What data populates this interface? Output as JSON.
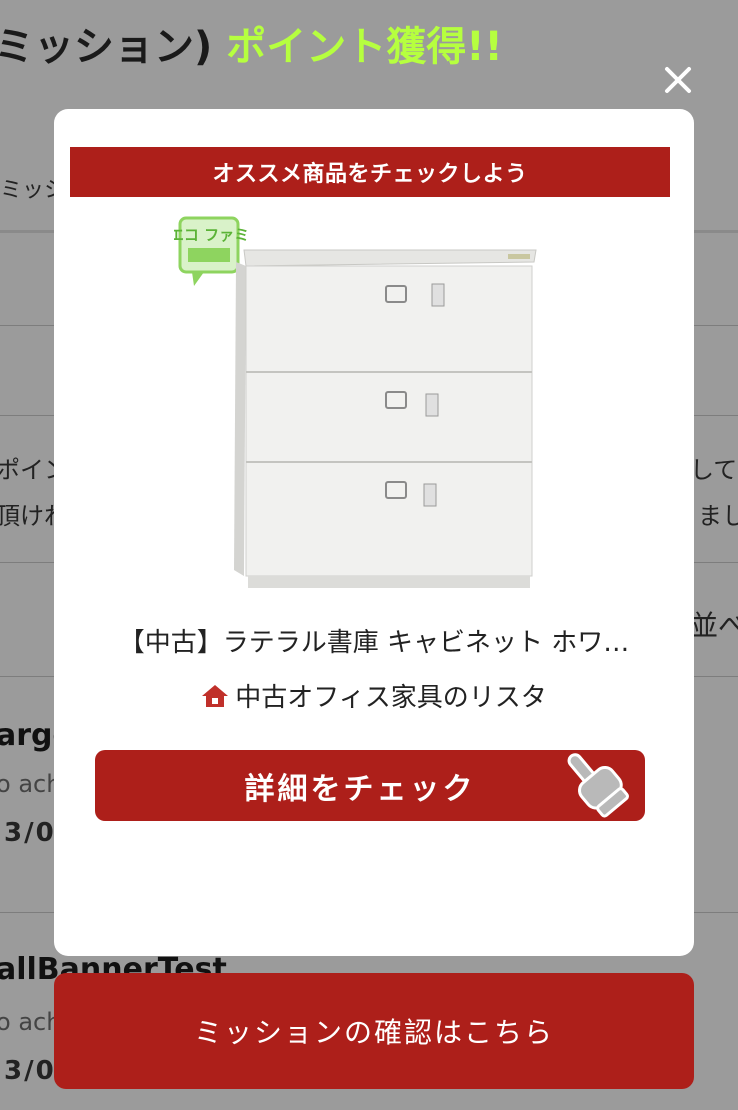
{
  "background": {
    "title_prefix": "ミッション)",
    "title_highlight": "ポイント獲得!!",
    "tab_fragment": "ミッシ",
    "text_left_1": "ポイン",
    "text_left_2": "頂けれ",
    "text_right_1": "して",
    "text_right_2": "まし",
    "sort_fragment": "並べ",
    "item1_title": "arge",
    "item1_sub": "o ach",
    "item1_date": "3/0",
    "item2_title": "allBannerTest",
    "item2_sub": "o ach",
    "item2_date": "3/0"
  },
  "modal": {
    "close_icon": "close-icon",
    "header": "オススメ商品をチェックしよう",
    "product_title": "【中古】ラテラル書庫 キャビネット ホワ…",
    "shop_icon": "home-icon",
    "shop_name": "中古オフィス家具のリスタ",
    "detail_button": "詳細をチェック",
    "detail_button_icon": "pointing-hand-icon",
    "logo_text": "エコ ファミ"
  },
  "footer": {
    "mission_button": "ミッションの確認はこちら"
  },
  "colors": {
    "accent_red": "#ad1f1a",
    "highlight_green": "#b6ff3f",
    "overlay_gray": "#9b9b9b"
  }
}
